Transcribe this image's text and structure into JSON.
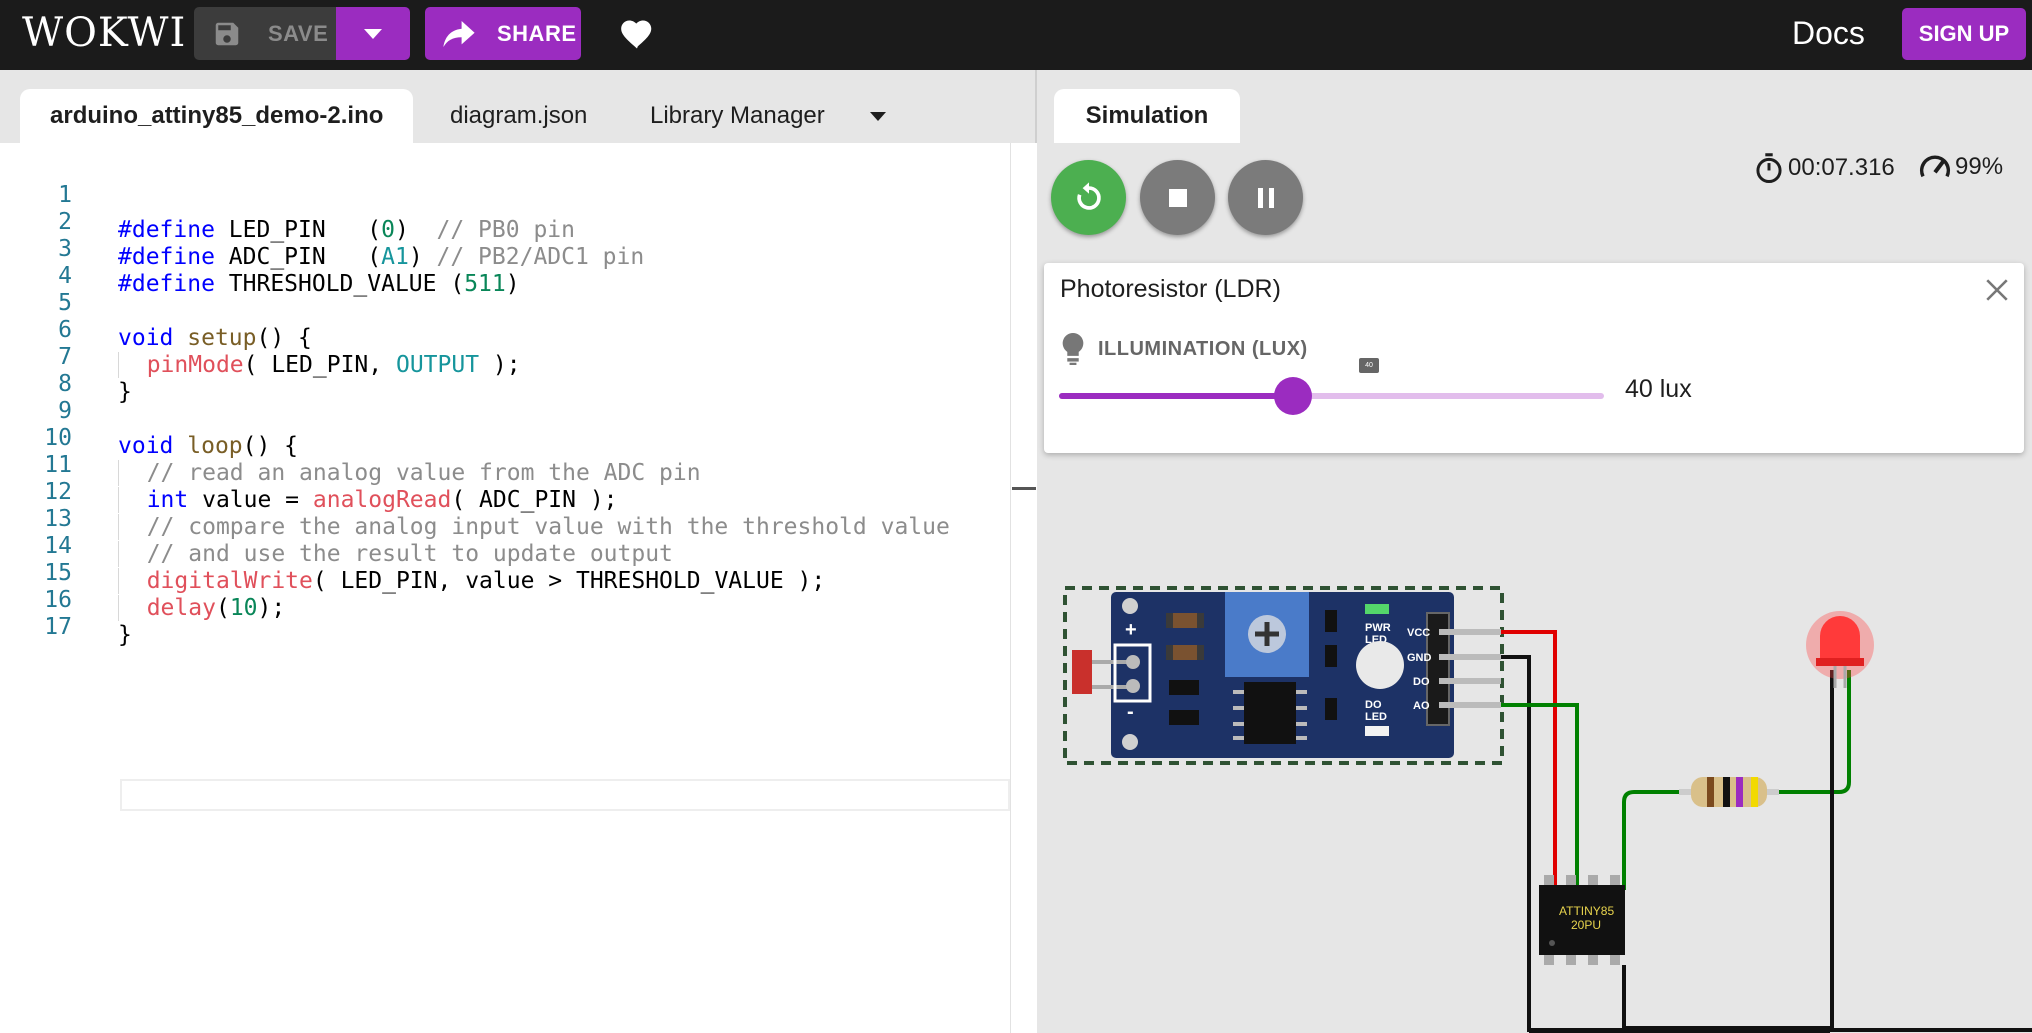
{
  "app": {
    "logo": "WOKWI",
    "save_label": "SAVE",
    "share_label": "SHARE",
    "docs_label": "Docs",
    "signup_label": "SIGN UP",
    "accent_color": "#9b2cc0"
  },
  "editor": {
    "tabs": [
      "arduino_attiny85_demo-2.ino",
      "diagram.json",
      "Library Manager"
    ],
    "active_tab": "arduino_attiny85_demo-2.ino",
    "line_numbers": [
      "1",
      "2",
      "3",
      "4",
      "5",
      "6",
      "7",
      "8",
      "9",
      "10",
      "11",
      "12",
      "13",
      "14",
      "15",
      "16",
      "17"
    ],
    "code_lines": [
      "#define LED_PIN   (0)  // PB0 pin",
      "#define ADC_PIN   (A1) // PB2/ADC1 pin",
      "#define THRESHOLD_VALUE (511)",
      "",
      "void setup() {",
      "  pinMode( LED_PIN, OUTPUT );",
      "}",
      "",
      "void loop() {",
      "  // read an analog value from the ADC pin",
      "  int value = analogRead( ADC_PIN );",
      "  // compare the analog input value with the threshold value",
      "  // and use the result to update output",
      "  digitalWrite( LED_PIN, value > THRESHOLD_VALUE );",
      "  delay(10);",
      "}",
      ""
    ]
  },
  "simulation": {
    "tab_label": "Simulation",
    "timer": "00:07.316",
    "performance": "99%",
    "popup": {
      "title": "Photoresistor (LDR)",
      "control_label": "ILLUMINATION (LUX)",
      "slider_tooltip": "40",
      "slider_fraction": 0.43,
      "value_text": "40 lux"
    },
    "module_labels": {
      "plus": "+",
      "minus": "-",
      "pwr_led": [
        "PWR",
        "LED"
      ],
      "do_led": [
        "DO",
        "LED"
      ],
      "pins": [
        "VCC",
        "GND",
        "DO",
        "AO"
      ]
    },
    "chip_label": [
      "ATTINY85",
      "20PU"
    ]
  }
}
